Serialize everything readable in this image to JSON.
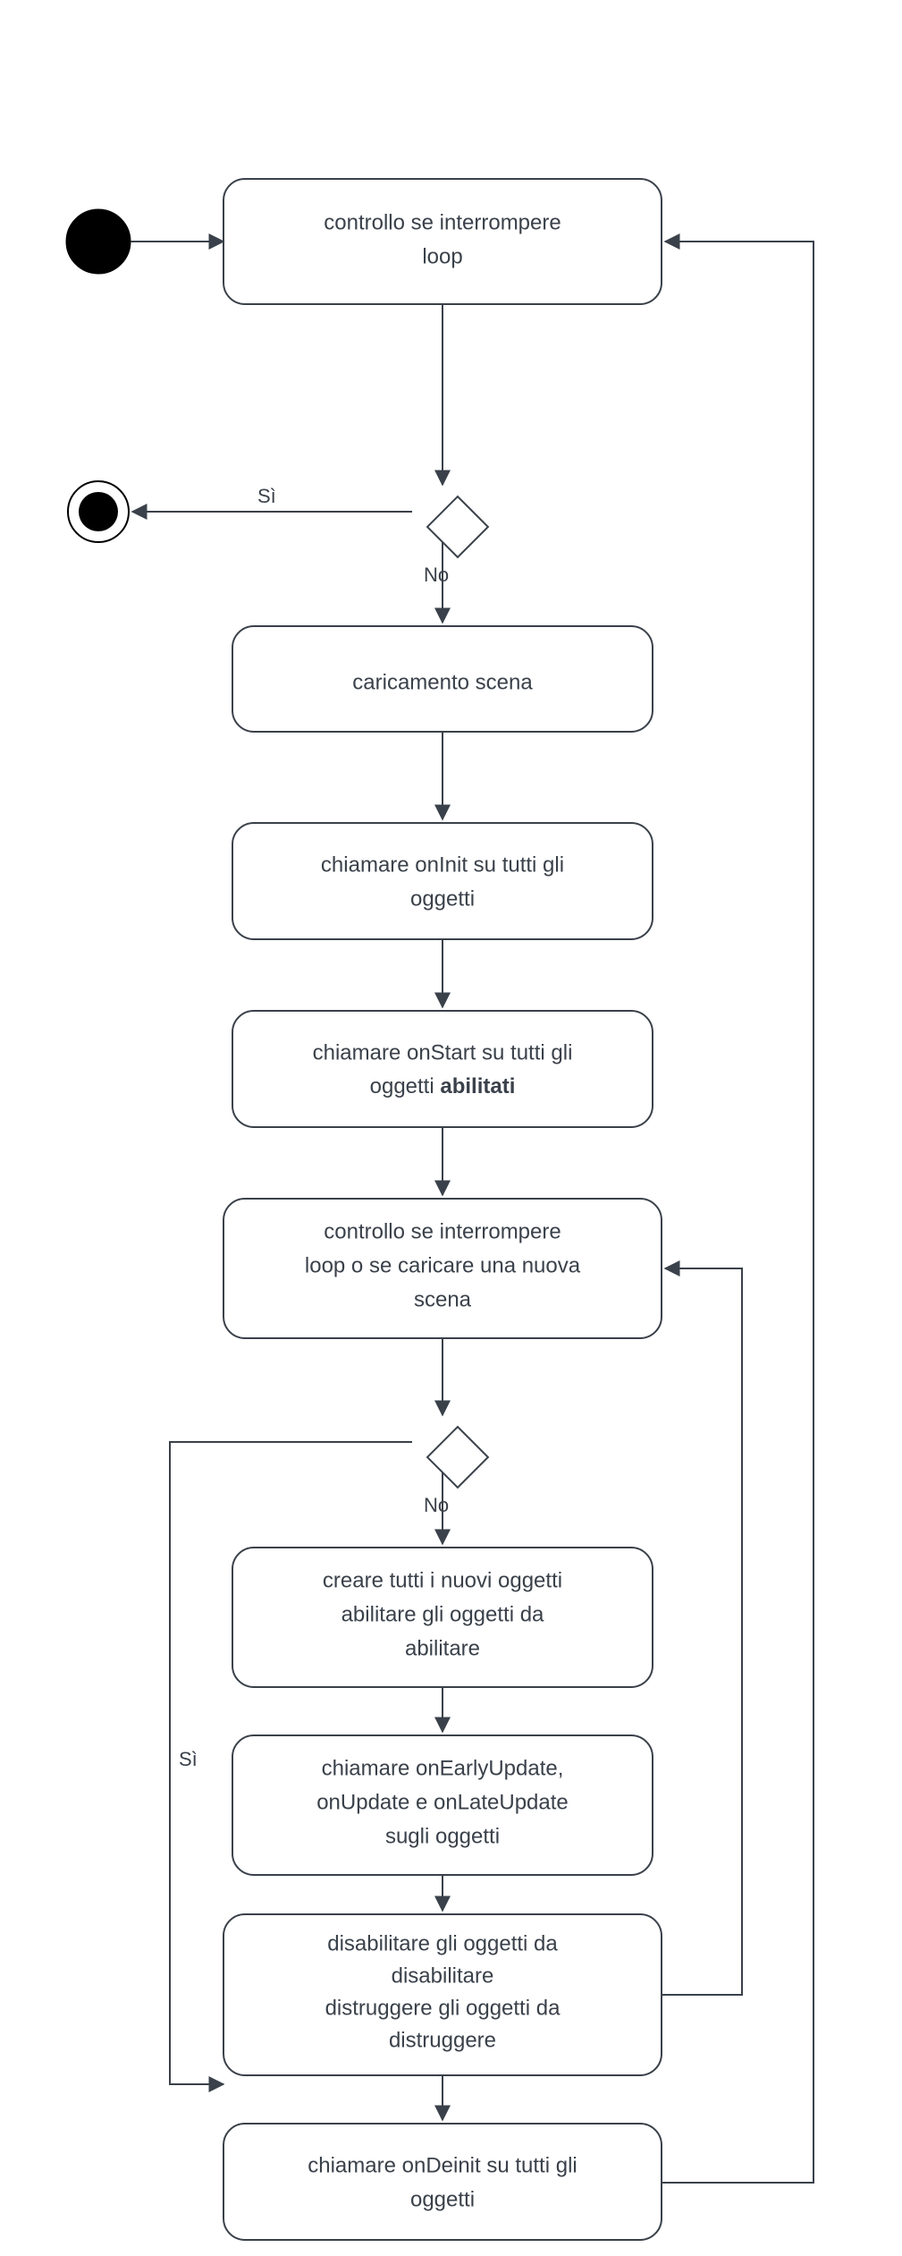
{
  "diagram_type": "uml_activity",
  "nodes": {
    "n1": {
      "text": "controllo se interrompere loop"
    },
    "n2": {
      "text": "caricamento scena"
    },
    "n3": {
      "text": "chiamare onInit su tutti gli oggetti"
    },
    "n4": {
      "line1": "chiamare onStart su tutti gli",
      "line2_prefix": "oggetti ",
      "line2_bold": "abilitati"
    },
    "n5": {
      "text": "controllo se interrompere loop o se caricare una nuova scena"
    },
    "n6": {
      "text": "creare tutti i nuovi oggetti abilitare gli oggetti da abilitare"
    },
    "n7": {
      "text": "chiamare onEarlyUpdate, onUpdate e onLateUpdate sugli oggetti"
    },
    "n8": {
      "text": "disabilitare gli oggetti da disabilitare distruggere gli oggetti da distruggere"
    },
    "n9": {
      "text": "chiamare onDeinit su tutti gli oggetti"
    }
  },
  "edge_labels": {
    "d1_yes": "Sì",
    "d1_no": "No",
    "d2_yes": "Sì",
    "d2_no": "No"
  }
}
